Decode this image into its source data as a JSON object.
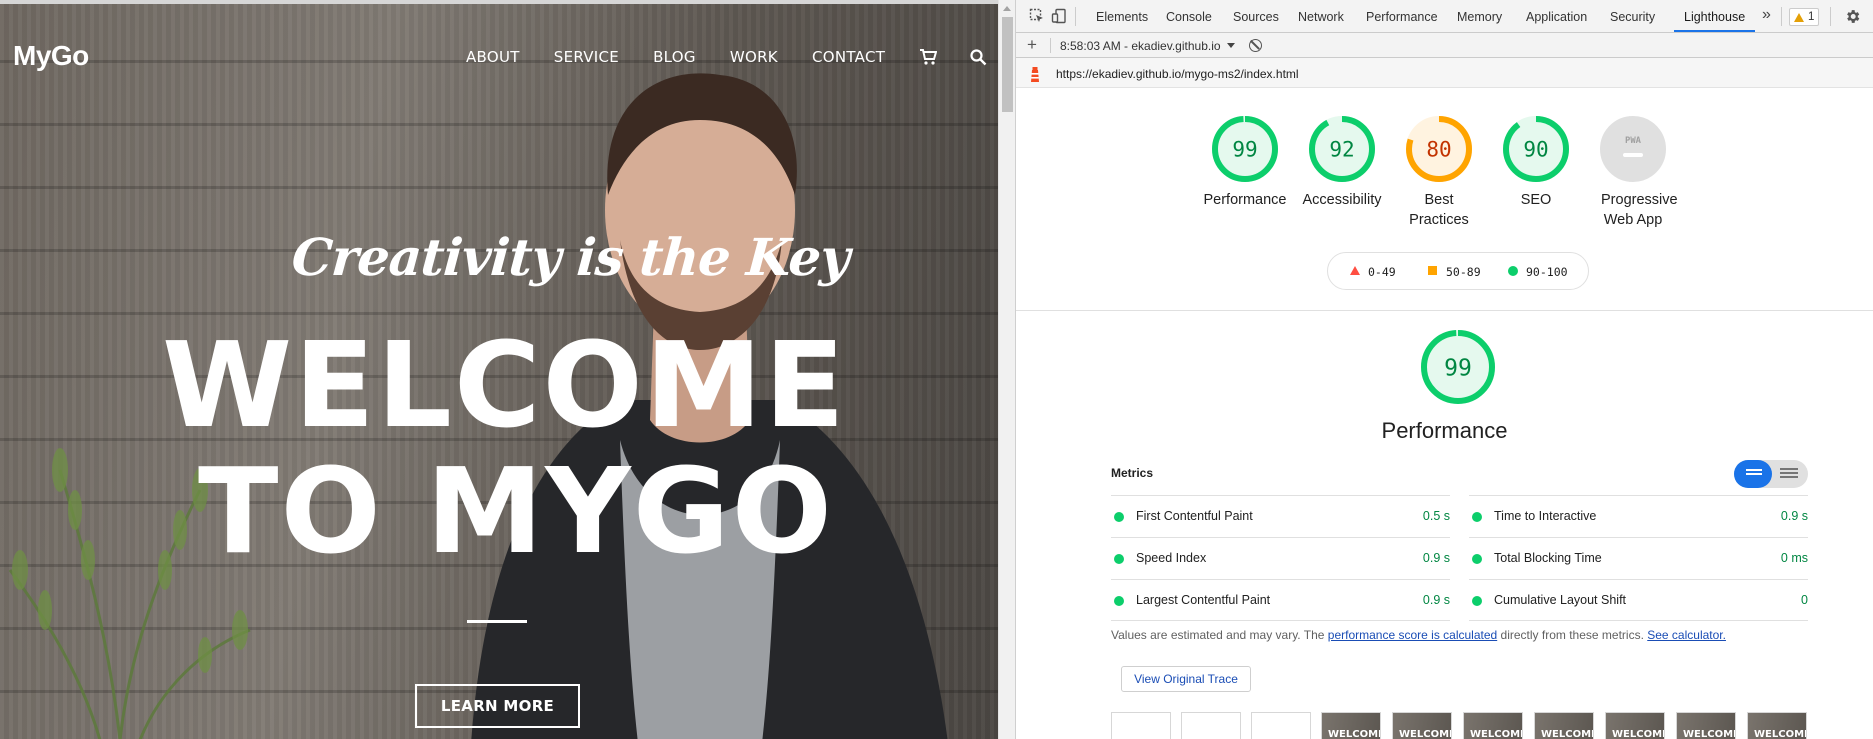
{
  "site": {
    "logo": "MyGo",
    "nav": [
      "ABOUT",
      "SERVICE",
      "BLOG",
      "WORK",
      "CONTACT"
    ],
    "tagline": "Creativity is the Key",
    "hero_line1": "WELCOME",
    "hero_line2": "TO MYGO",
    "cta": "LEARN MORE"
  },
  "devtools": {
    "tabs": [
      "Elements",
      "Console",
      "Sources",
      "Network",
      "Performance",
      "Memory",
      "Application",
      "Security",
      "Lighthouse"
    ],
    "active_tab": "Lighthouse",
    "warning_count": "1",
    "report_label": "8:58:03 AM - ekadiev.github.io",
    "url": "https://ekadiev.github.io/mygo-ms2/index.html"
  },
  "lighthouse": {
    "gauges": [
      {
        "label": "Performance",
        "score": "99",
        "status": "pass"
      },
      {
        "label": "Accessibility",
        "score": "92",
        "status": "pass"
      },
      {
        "label": "Best Practices",
        "score": "80",
        "status": "average"
      },
      {
        "label": "SEO",
        "score": "90",
        "status": "pass"
      },
      {
        "label": "Progressive Web App",
        "score": "PWA",
        "status": "na"
      }
    ],
    "legend": [
      "0-49",
      "50-89",
      "90-100"
    ],
    "category_title": "Performance",
    "category_score": "99",
    "metrics_heading": "Metrics",
    "metrics_left": [
      {
        "name": "First Contentful Paint",
        "value": "0.5 s"
      },
      {
        "name": "Speed Index",
        "value": "0.9 s"
      },
      {
        "name": "Largest Contentful Paint",
        "value": "0.9 s"
      }
    ],
    "metrics_right": [
      {
        "name": "Time to Interactive",
        "value": "0.9 s"
      },
      {
        "name": "Total Blocking Time",
        "value": "0 ms"
      },
      {
        "name": "Cumulative Layout Shift",
        "value": "0"
      }
    ],
    "note_prefix": "Values are estimated and may vary. The ",
    "note_link1": "performance score is calculated",
    "note_mid": " directly from these metrics. ",
    "note_link2": "See calculator.",
    "trace_button": "View Original Trace"
  },
  "colors": {
    "pass": "#0cce6b",
    "average": "#ffa400",
    "fail": "#ff4e42",
    "accent": "#1a73e8"
  }
}
